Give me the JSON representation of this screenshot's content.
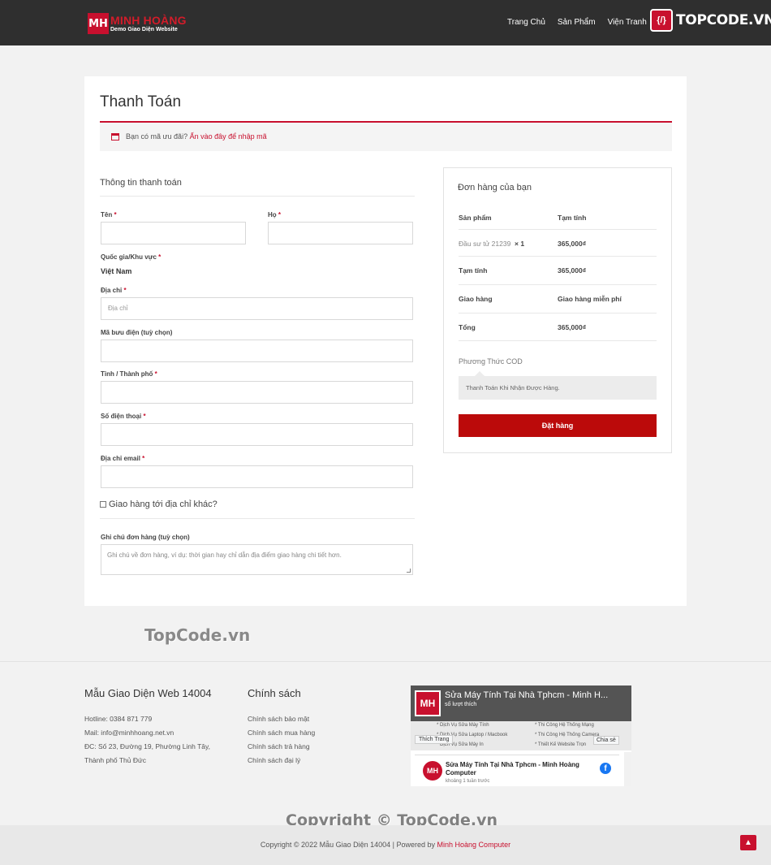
{
  "header": {
    "logo_mark": "MH",
    "logo_name": "MINH HOÀNG",
    "logo_sub": "Demo Giao Diện Website",
    "nav": [
      "Trang Chủ",
      "Sản Phẩm",
      "Viện Tranh"
    ],
    "brand_mark": "{/}",
    "brand_text": "TOPCODE.VN"
  },
  "main": {
    "page_title": "Thanh Toán",
    "coupon_text": "Bạn có mã ưu đãi?",
    "coupon_link": "Ấn vào đây để nhập mã",
    "billing_title": "Thông tin thanh toán",
    "fields": {
      "first_name_label": "Tên",
      "last_name_label": "Họ",
      "country_label": "Quốc gia/Khu vực",
      "country_value": "Việt Nam",
      "address_label": "Địa chỉ",
      "address_placeholder": "Địa chỉ",
      "postcode_label": "Mã bưu điện (tuỳ chọn)",
      "city_label": "Tỉnh / Thành phố",
      "phone_label": "Số điện thoại",
      "email_label": "Địa chỉ email",
      "required_mark": "*"
    },
    "ship_other_label": "Giao hàng tới địa chỉ khác?",
    "notes_label": "Ghi chú đơn hàng (tuỳ chọn)",
    "notes_placeholder": "Ghi chú về đơn hàng, ví dụ: thời gian hay chỉ dẫn địa điểm giao hàng chi tiết hơn."
  },
  "order": {
    "title": "Đơn hàng của bạn",
    "col_product": "Sản phẩm",
    "col_subtotal": "Tạm tính",
    "item_name": "Đầu sư tử 21239",
    "item_qty": "× 1",
    "item_price": "365,000₫",
    "subtotal_label": "Tạm tính",
    "subtotal_value": "365,000₫",
    "shipping_label": "Giao hàng",
    "shipping_value": "Giao hàng miễn phí",
    "total_label": "Tổng",
    "total_value": "365,000₫",
    "payment_method": "Phương Thức COD",
    "payment_desc": "Thanh Toán Khi Nhận Được Hàng.",
    "place_order": "Đặt hàng"
  },
  "watermarks": {
    "top": "TopCode.vn",
    "bottom": "Copyright © TopCode.vn"
  },
  "footer": {
    "col1_title": "Mẫu Giao Diện Web 14004",
    "hotline": "Hotline: 0384 871 779",
    "mail": "Mail: info@minhhoang.net.vn",
    "address_line1": "ĐC: Số 23, Đường 19, Phường Linh Tây,",
    "address_line2": "Thành phố Thủ Đức",
    "col2_title": "Chính sách",
    "policies": [
      "Chính sách bảo mật",
      "Chính sách mua hàng",
      "Chính sách trả hàng",
      "Chính sách đại lý"
    ],
    "fb": {
      "logo": "MH",
      "page_name": "Sửa Máy Tính Tại Nhà Tphcm - Minh H...",
      "likes": "số lượt thích",
      "list_left": [
        "* Dịch Vụ Sửa Máy Tính",
        "* Dịch Vụ Sửa Laptop / Macbook",
        "* Dịch Vụ Sửa Máy In"
      ],
      "list_right": [
        "* Thi Công Hệ Thống Mạng",
        "* Thi Công Hệ Thống Camera",
        "* Thiết Kế Website Trọn"
      ],
      "like_btn": "Thích Trang",
      "share_btn": "Chia sẻ",
      "post_name": "Sửa Máy Tính Tại Nhà Tphcm - Minh Hoàng Computer",
      "post_time": "khoảng 1 tuần trước",
      "f_icon": "f"
    },
    "copyright_text": "Copyright © 2022 Mẫu Giao Diện 14004 | Powered by",
    "copyright_link": "Minh Hoàng Computer"
  },
  "colors": {
    "accent": "#c8102e",
    "button": "#bb0a0a",
    "header_bg": "#2f2f2f"
  }
}
